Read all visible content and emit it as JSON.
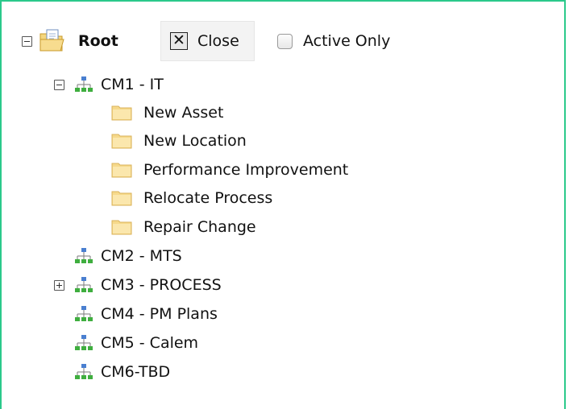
{
  "toolbar": {
    "root_label": "Root",
    "close_label": "Close",
    "active_only_label": "Active Only"
  },
  "tree": {
    "nodes": [
      {
        "label": "CM1 - IT",
        "expanded": true,
        "children": [
          {
            "label": "New Asset"
          },
          {
            "label": "New Location"
          },
          {
            "label": "Performance Improvement"
          },
          {
            "label": "Relocate Process"
          },
          {
            "label": "Repair Change"
          }
        ]
      },
      {
        "label": "CM2 - MTS"
      },
      {
        "label": "CM3 - PROCESS",
        "expanded": false
      },
      {
        "label": "CM4 - PM Plans"
      },
      {
        "label": "CM5 - Calem"
      },
      {
        "label": "CM6-TBD"
      }
    ]
  },
  "icons": {
    "expander_expanded": "collapse-icon",
    "expander_collapsed": "expand-icon",
    "root": "open-folder-icon",
    "category": "hierarchy-icon",
    "leaf": "folder-icon",
    "close": "close-x-icon"
  }
}
